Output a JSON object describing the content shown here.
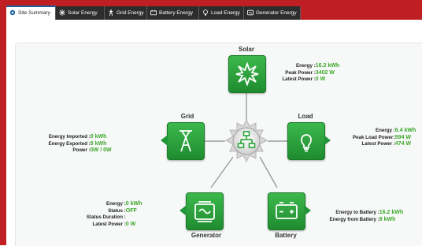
{
  "tabs": [
    {
      "label": "Site Summary",
      "icon": "site-summary-icon",
      "active": true
    },
    {
      "label": "Solar Energy",
      "icon": "solar-icon",
      "active": false
    },
    {
      "label": "Grid Energy",
      "icon": "grid-tower-icon",
      "active": false
    },
    {
      "label": "Battery Energy",
      "icon": "battery-icon",
      "active": false
    },
    {
      "label": "Load Energy",
      "icon": "bulb-icon",
      "active": false
    },
    {
      "label": "Generator Energy",
      "icon": "generator-icon",
      "active": false
    }
  ],
  "nodes": {
    "solar": {
      "title": "Solar"
    },
    "grid": {
      "title": "Grid"
    },
    "load": {
      "title": "Load"
    },
    "generator": {
      "title": "Generator"
    },
    "battery": {
      "title": "Battery"
    }
  },
  "solar_info": [
    {
      "key": "Energy",
      "value": "16.2 kWh"
    },
    {
      "key": "Peak Power",
      "value": "3402 W"
    },
    {
      "key": "Latest Power",
      "value": "0 W"
    }
  ],
  "grid_info": [
    {
      "key": "Energy Imported",
      "value": "0 kWh"
    },
    {
      "key": "Energy Exported",
      "value": "0 kWh"
    },
    {
      "key": "Power",
      "value": "0W / 0W"
    }
  ],
  "load_info": [
    {
      "key": "Energy",
      "value": "6.4 kWh"
    },
    {
      "key": "Peak Load Power",
      "value": "594 W"
    },
    {
      "key": "Latest Power",
      "value": "474 W"
    }
  ],
  "generator_info": [
    {
      "key": "Energy",
      "value": "0 kWh"
    },
    {
      "key": "Status",
      "value": "OFF"
    },
    {
      "key": "Status Duration",
      "value": ""
    },
    {
      "key": "Latest Power",
      "value": "0 W"
    }
  ],
  "battery_info": [
    {
      "key": "Energy to Battery",
      "value": "16.2 kWh"
    },
    {
      "key": "Energy from Battery",
      "value": "8 kWh"
    }
  ],
  "colors": {
    "frame": "#bf1e22",
    "node_green": "#2aa43a",
    "value_green": "#3aa827",
    "tab_dark": "#2d2d2d"
  }
}
